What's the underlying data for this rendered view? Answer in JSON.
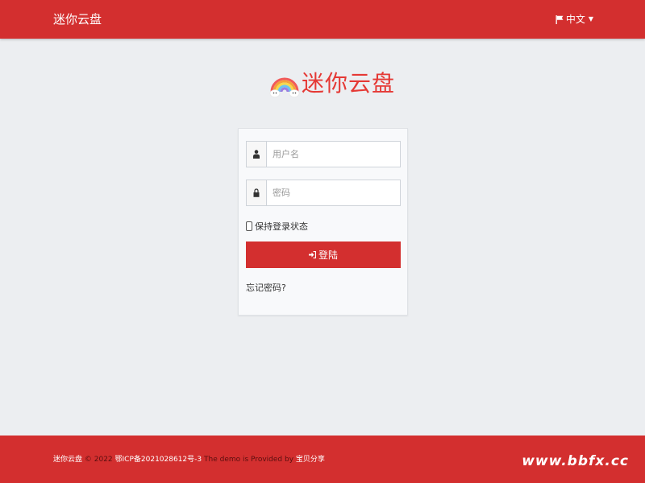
{
  "header": {
    "brand": "迷你云盘",
    "language": "中文"
  },
  "logo": {
    "text": "迷你云盘"
  },
  "login": {
    "username_placeholder": "用户名",
    "password_placeholder": "密码",
    "remember_label": "保持登录状态",
    "submit_label": "登陆",
    "forgot_label": "忘记密码?"
  },
  "footer": {
    "brand": "迷你云盘",
    "copyright": "© 2022",
    "icp": "鄂ICP备2021028612号-3",
    "demo_text": "The demo is Provided by",
    "provider": "宝贝分享",
    "watermark": "www.bbfx.cc"
  },
  "colors": {
    "primary": "#d32f2f",
    "logo_text": "#e53935",
    "background": "#eceef1"
  }
}
